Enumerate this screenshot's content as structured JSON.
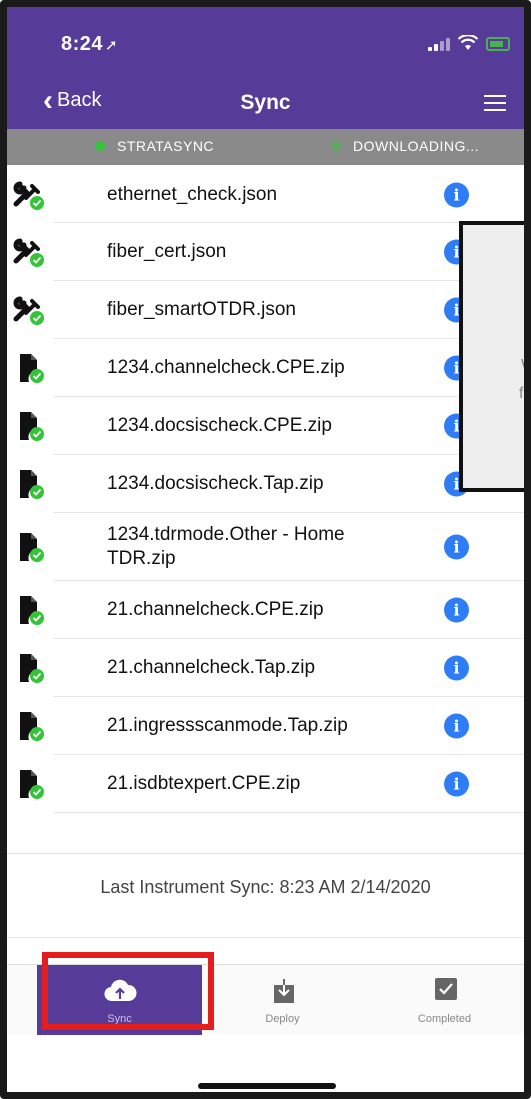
{
  "status_bar": {
    "time": "8:24",
    "location_icon": "location-arrow-icon"
  },
  "nav": {
    "back_label": "Back",
    "title": "Sync"
  },
  "sync_strip": [
    {
      "label": "STRATASYNC",
      "dot_color": "#33c437"
    },
    {
      "label": "DOWNLOADING...",
      "dot_color": "#5fa85f"
    }
  ],
  "files": [
    {
      "name": "ethernet_check.json",
      "icon": "wrench-check-icon"
    },
    {
      "name": "fiber_cert.json",
      "icon": "wrench-check-icon"
    },
    {
      "name": "fiber_smartOTDR.json",
      "icon": "wrench-check-icon"
    },
    {
      "name": "1234.channelcheck.CPE.zip",
      "icon": "file-check-icon"
    },
    {
      "name": "1234.docsischeck.CPE.zip",
      "icon": "file-check-icon"
    },
    {
      "name": "1234.docsischeck.Tap.zip",
      "icon": "file-check-icon"
    },
    {
      "name": "1234.tdrmode.Other - Home TDR.zip",
      "icon": "file-check-icon"
    },
    {
      "name": "21.channelcheck.CPE.zip",
      "icon": "file-check-icon"
    },
    {
      "name": "21.channelcheck.Tap.zip",
      "icon": "file-check-icon"
    },
    {
      "name": "21.ingressscanmode.Tap.zip",
      "icon": "file-check-icon"
    },
    {
      "name": "21.isdbtexpert.CPE.zip",
      "icon": "file-check-icon"
    }
  ],
  "info_icon_glyph": "i",
  "overlay": {
    "line1": "W",
    "line2": "fr"
  },
  "last_sync": "Last Instrument Sync: 8:23 AM 2/14/2020",
  "tabs": [
    {
      "label": "Sync",
      "icon": "cloud-upload-icon"
    },
    {
      "label": "Deploy",
      "icon": "download-box-icon"
    },
    {
      "label": "Completed",
      "icon": "checkbox-icon"
    }
  ],
  "colors": {
    "brand": "#563c98",
    "info": "#2e7cf6",
    "success": "#33c437",
    "highlight": "#e41e1e"
  }
}
